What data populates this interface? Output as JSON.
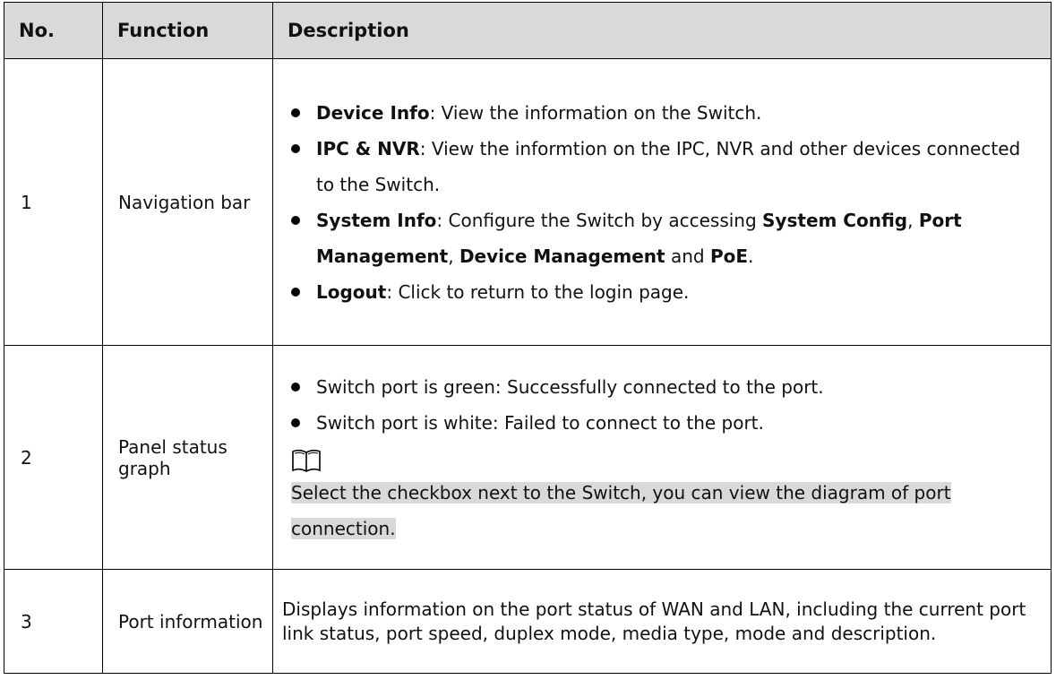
{
  "headers": {
    "no": "No.",
    "function": "Function",
    "description": "Description"
  },
  "row1": {
    "no": "1",
    "function": "Navigation bar",
    "items": {
      "device_info": {
        "term": "Device Info",
        "text": ": View the information on the Switch."
      },
      "ipc_nvr": {
        "term": "IPC & NVR",
        "text": ": View the informtion on the IPC, NVR and other devices connected to the Switch."
      },
      "system_info": {
        "term": "System Info",
        "text": ": Configure the Switch by accessing ",
        "t1": "System Config",
        "s1": ", ",
        "t2": "Port Management",
        "s2": ", ",
        "t3": "Device Management",
        "s3": " and ",
        "t4": "PoE",
        "s4": "."
      },
      "logout": {
        "term": "Logout",
        "text": ": Click to return to the login page."
      }
    }
  },
  "row2": {
    "no": "2",
    "function": "Panel status graph",
    "bullets": [
      "Switch port is green: Successfully connected to the port.",
      "Switch port is white: Failed to connect to the port."
    ],
    "note_icon": "book-icon",
    "note": "Select the checkbox next to the Switch, you can view the diagram of port connection."
  },
  "row3": {
    "no": "3",
    "function": "Port information",
    "description": "Displays information on the port status of WAN and LAN, including the current port link status, port speed, duplex mode, media type, mode and description."
  }
}
